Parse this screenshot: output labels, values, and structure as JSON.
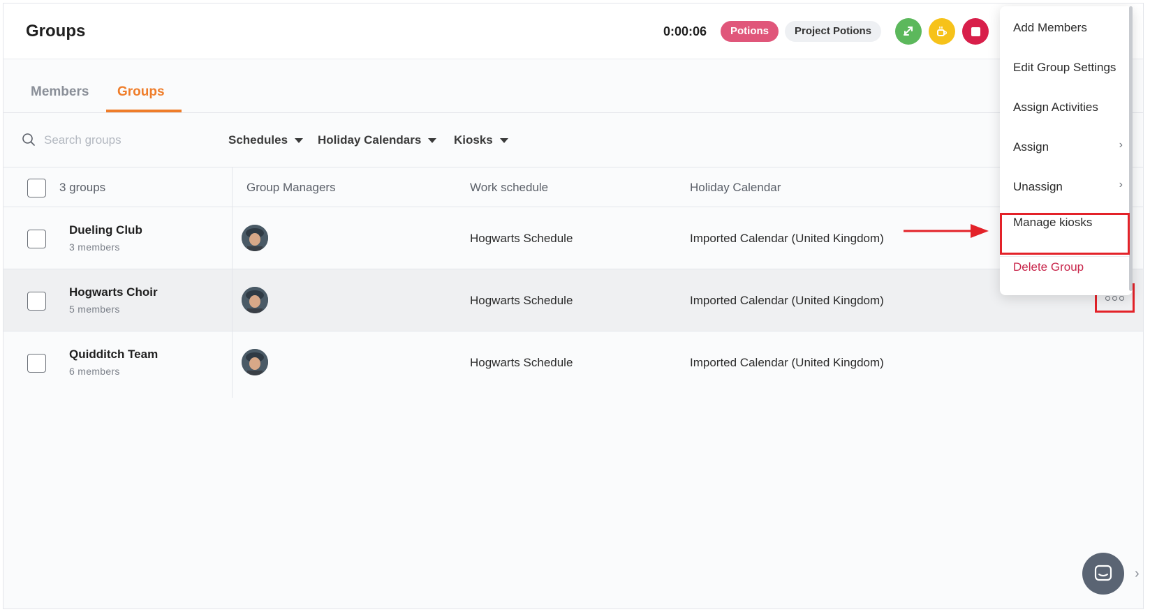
{
  "header": {
    "title": "Groups",
    "timer": "0:00:06",
    "activity_badge": "Potions",
    "project_badge": "Project Potions"
  },
  "tabs": [
    {
      "label": "Members",
      "active": false
    },
    {
      "label": "Groups",
      "active": true
    }
  ],
  "filters": {
    "search_placeholder": "Search groups",
    "schedules": "Schedules",
    "holiday_calendars": "Holiday Calendars",
    "kiosks": "Kiosks"
  },
  "table": {
    "count_label": "3 groups",
    "columns": [
      "Group Managers",
      "Work schedule",
      "Holiday Calendar"
    ],
    "rows": [
      {
        "name": "Dueling Club",
        "members": "3 members",
        "schedule": "Hogwarts Schedule",
        "calendar": "Imported Calendar (United Kingdom)"
      },
      {
        "name": "Hogwarts Choir",
        "members": "5 members",
        "schedule": "Hogwarts Schedule",
        "calendar": "Imported Calendar (United Kingdom)"
      },
      {
        "name": "Quidditch Team",
        "members": "6 members",
        "schedule": "Hogwarts Schedule",
        "calendar": "Imported Calendar (United Kingdom)"
      }
    ]
  },
  "menu": {
    "items": [
      {
        "label": "Add Members"
      },
      {
        "label": "Edit Group Settings"
      },
      {
        "label": "Assign Activities"
      },
      {
        "label": "Assign"
      },
      {
        "label": "Unassign"
      },
      {
        "label": "Manage kiosks"
      },
      {
        "label": "Delete Group"
      }
    ]
  },
  "colors": {
    "accent": "#ef7d2a",
    "activity_badge": "#e0567a",
    "highlight": "#e32229",
    "delete": "#c8254a",
    "switch_button": "#5cb85c",
    "break_button": "#f6c21a",
    "stop_button": "#d81f4a"
  },
  "icons": [
    "search-icon",
    "chevron-down-icon",
    "switch-activity-icon",
    "coffee-break-icon",
    "stop-icon",
    "chevron-right-icon",
    "more-options-icon",
    "chat-icon"
  ]
}
